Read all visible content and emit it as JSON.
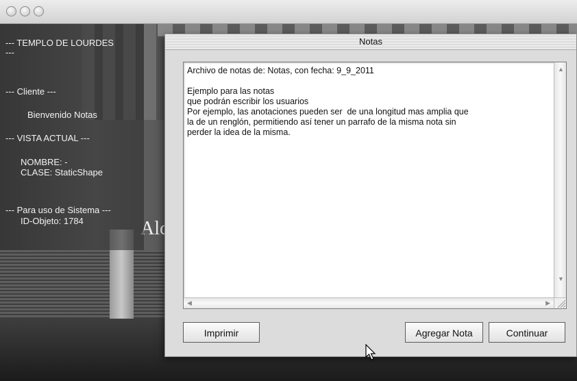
{
  "window": {
    "buttons": [
      "close-icon",
      "minimize-icon",
      "zoom-icon"
    ]
  },
  "sidebar": {
    "title_line": "--- TEMPLO DE LOURDES",
    "title_tail": "---",
    "client_header": "--- Cliente ---",
    "welcome": "Bienvenido Notas",
    "view_header": "--- VISTA ACTUAL ---",
    "name_line": "NOMBRE: -",
    "class_line": "CLASE: StaticShape",
    "system_header": "--- Para uso de Sistema ---",
    "object_id": "ID-Objeto: 1784"
  },
  "scene": {
    "sign_text": "Alc"
  },
  "dialog": {
    "title": "Notas",
    "text": "Archivo de notas de: Notas, con fecha: 9_9_2011\n\nEjemplo para las notas\nque podrán escribir los usuarios\nPor ejemplo, las anotaciones pueden ser  de una longitud mas amplia que\nla de un renglón, permitiendo así tener un parrafo de la misma nota sin\nperder la idea de la misma.",
    "buttons": {
      "print": "Imprimir",
      "add_note": "Agregar Nota",
      "continue": "Continuar"
    }
  }
}
